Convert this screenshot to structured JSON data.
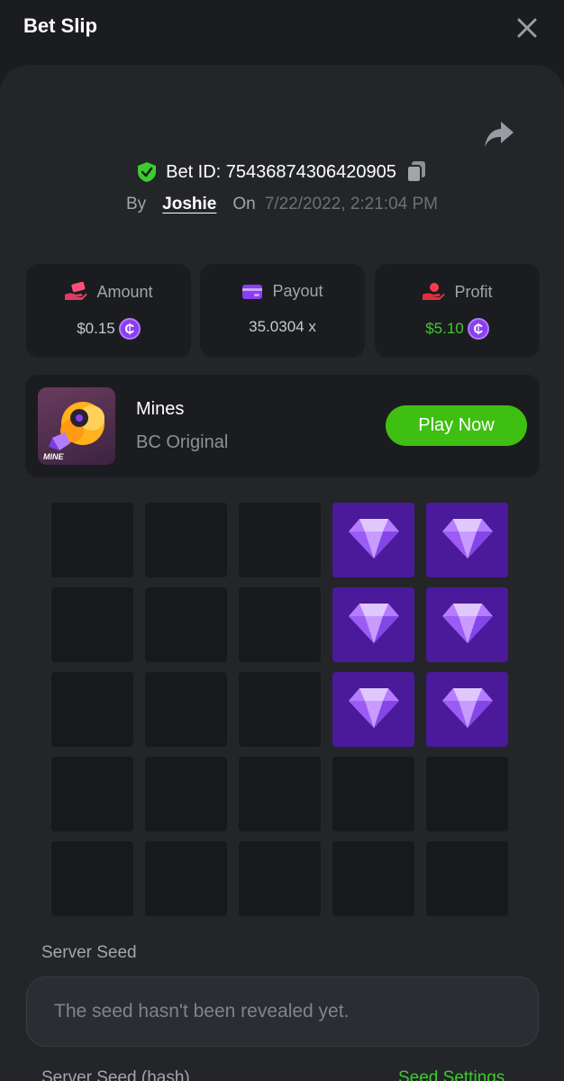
{
  "header": {
    "title": "Bet Slip",
    "close_icon": "close-icon"
  },
  "bet": {
    "id_label": "Bet ID: 75436874306420905",
    "by_label": "By",
    "user": "Joshie",
    "on_label": "On",
    "date": "7/22/2022, 2:21:04 PM"
  },
  "stats": {
    "amount": {
      "label": "Amount",
      "value": "$0.15",
      "icon": "money-hand-icon"
    },
    "payout": {
      "label": "Payout",
      "value": "35.0304 x",
      "icon": "wallet-card-icon"
    },
    "profit": {
      "label": "Profit",
      "value": "$5.10",
      "icon": "profit-hand-icon"
    }
  },
  "game": {
    "name": "Mines",
    "subtitle": "BC Original",
    "thumb_text": "MINE",
    "play_label": "Play Now"
  },
  "board": {
    "rows": 5,
    "cols": 5,
    "cells": [
      "empty",
      "empty",
      "empty",
      "gem",
      "gem",
      "empty",
      "empty",
      "empty",
      "gem",
      "gem",
      "empty",
      "empty",
      "empty",
      "gem",
      "gem",
      "empty",
      "empty",
      "empty",
      "empty",
      "empty",
      "empty",
      "empty",
      "empty",
      "empty",
      "empty"
    ]
  },
  "seeds": {
    "server_seed_label": "Server Seed",
    "server_seed_value": "The seed hasn't been revealed yet.",
    "server_seed_hash_label": "Server Seed (hash)",
    "settings_label": "Seed Settings"
  },
  "colors": {
    "accent_green": "#3fbf12",
    "gem_cell": "#4a1a9a",
    "coin": "#8a3ff0"
  }
}
